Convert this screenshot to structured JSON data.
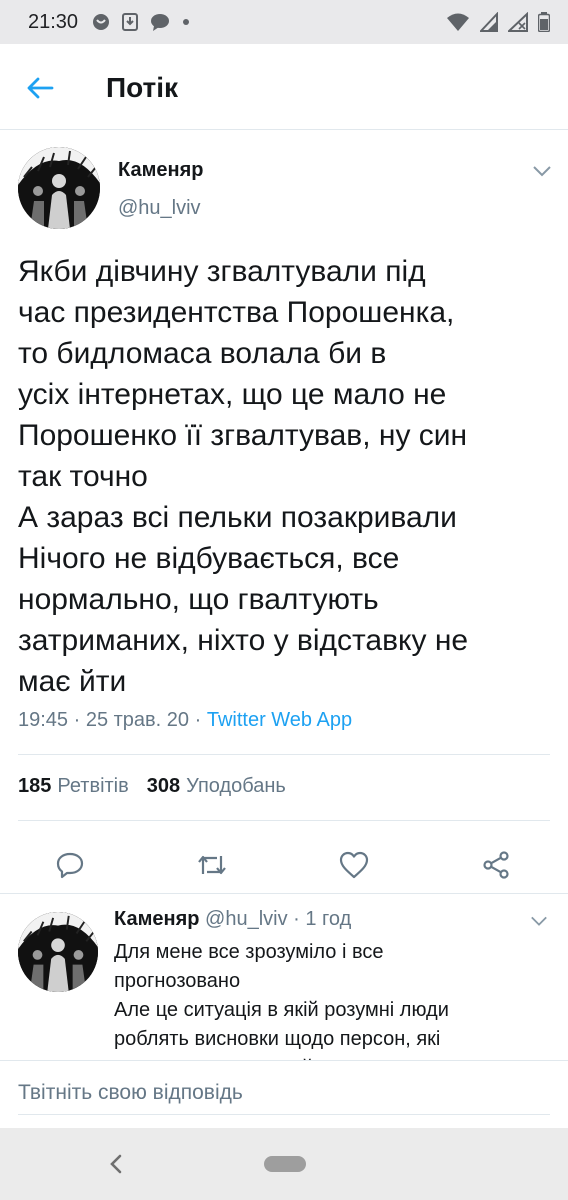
{
  "status_bar": {
    "time": "21:30",
    "left_icons": [
      "settings-icon",
      "download-icon",
      "message-icon",
      "dot-icon"
    ],
    "right_icons": [
      "wifi-icon",
      "signal-icon",
      "no-signal-icon",
      "battery-icon"
    ]
  },
  "header": {
    "back_icon": "arrow-left-icon",
    "title": "Потік"
  },
  "tweet": {
    "user_name": "Каменяр",
    "handle": "@hu_lviv",
    "text": "Якби дівчину згвалтували під\nчас президентства Порошенка,\nто бидломаса волала би в\nусіх інтернетах, що це мало не\nПорошенко її згвалтував, ну син\nтак точно\nА зараз всі пельки позакривали\nНічого не відбувається, все\nнормально, що гвалтують\nзатриманих, ніхто у відставку не\nмає йти",
    "time": "19:45",
    "separator": " · ",
    "date": "25 трав. 20",
    "source": "Twitter Web App",
    "retweets_count": "185",
    "retweets_label": "Ретвітів",
    "likes_count": "308",
    "likes_label": "Уподобань"
  },
  "actions": [
    "reply-icon",
    "retweet-icon",
    "like-icon",
    "share-icon"
  ],
  "reply": {
    "user_name": "Каменяр",
    "handle": "@hu_lviv",
    "separator": " · ",
    "time": "1 год",
    "text": "Для мене все зрозуміло і все\nпрогнозовано\nАле це ситуація в якій розумні люди\nроблять висновки щодо персон, які\nнаступного разу пройдуть у владу"
  },
  "compose": {
    "placeholder": "Твітніть свою відповідь"
  },
  "colors": {
    "accent": "#1da1f2",
    "text": "#14171a",
    "muted": "#657786",
    "divider": "#e1e8ed"
  }
}
